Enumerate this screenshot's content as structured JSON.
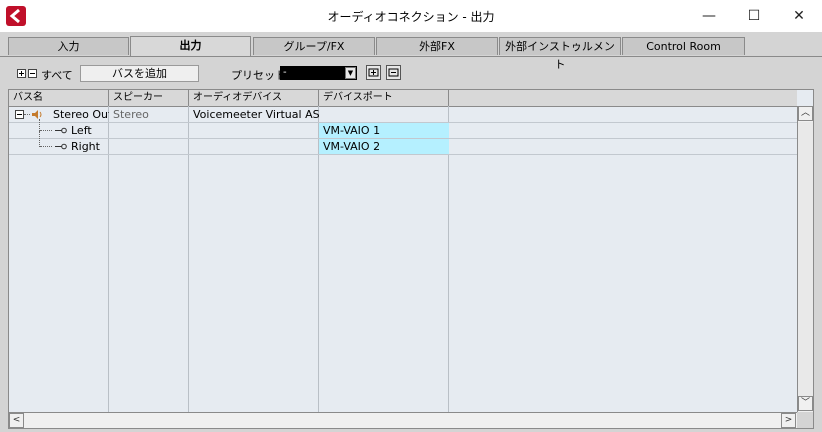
{
  "window": {
    "title": "オーディオコネクション - 出力",
    "min_icon": "—",
    "max_icon": "☐",
    "close_icon": "✕"
  },
  "tabs": [
    {
      "label": "入力",
      "active": false
    },
    {
      "label": "出力",
      "active": true
    },
    {
      "label": "グループ/FX",
      "active": false
    },
    {
      "label": "外部FX",
      "active": false
    },
    {
      "label": "外部インストゥルメント",
      "active": false
    },
    {
      "label": "Control Room",
      "active": false
    }
  ],
  "toolbar": {
    "all_label": "すべて",
    "add_bus_label": "バスを追加",
    "preset_label": "プリセット",
    "preset_value": "-"
  },
  "columns": [
    "バス名",
    "スピーカー",
    "オーディオデバイス",
    "デバイスポート"
  ],
  "rows": [
    {
      "bus_name": "Stereo Out",
      "speaker": "Stereo",
      "device": "Voicemeeter Virtual ASIO",
      "port": ""
    },
    {
      "bus_name": "Left",
      "speaker": "",
      "device": "",
      "port": "VM-VAIO 1"
    },
    {
      "bus_name": "Right",
      "speaker": "",
      "device": "",
      "port": "VM-VAIO 2"
    }
  ],
  "scroll": {
    "up": "︿",
    "down": "﹀",
    "left": "<",
    "right": ">"
  },
  "colors": {
    "port_highlight": "#b5f0ff",
    "logo_red": "#c0102a"
  }
}
